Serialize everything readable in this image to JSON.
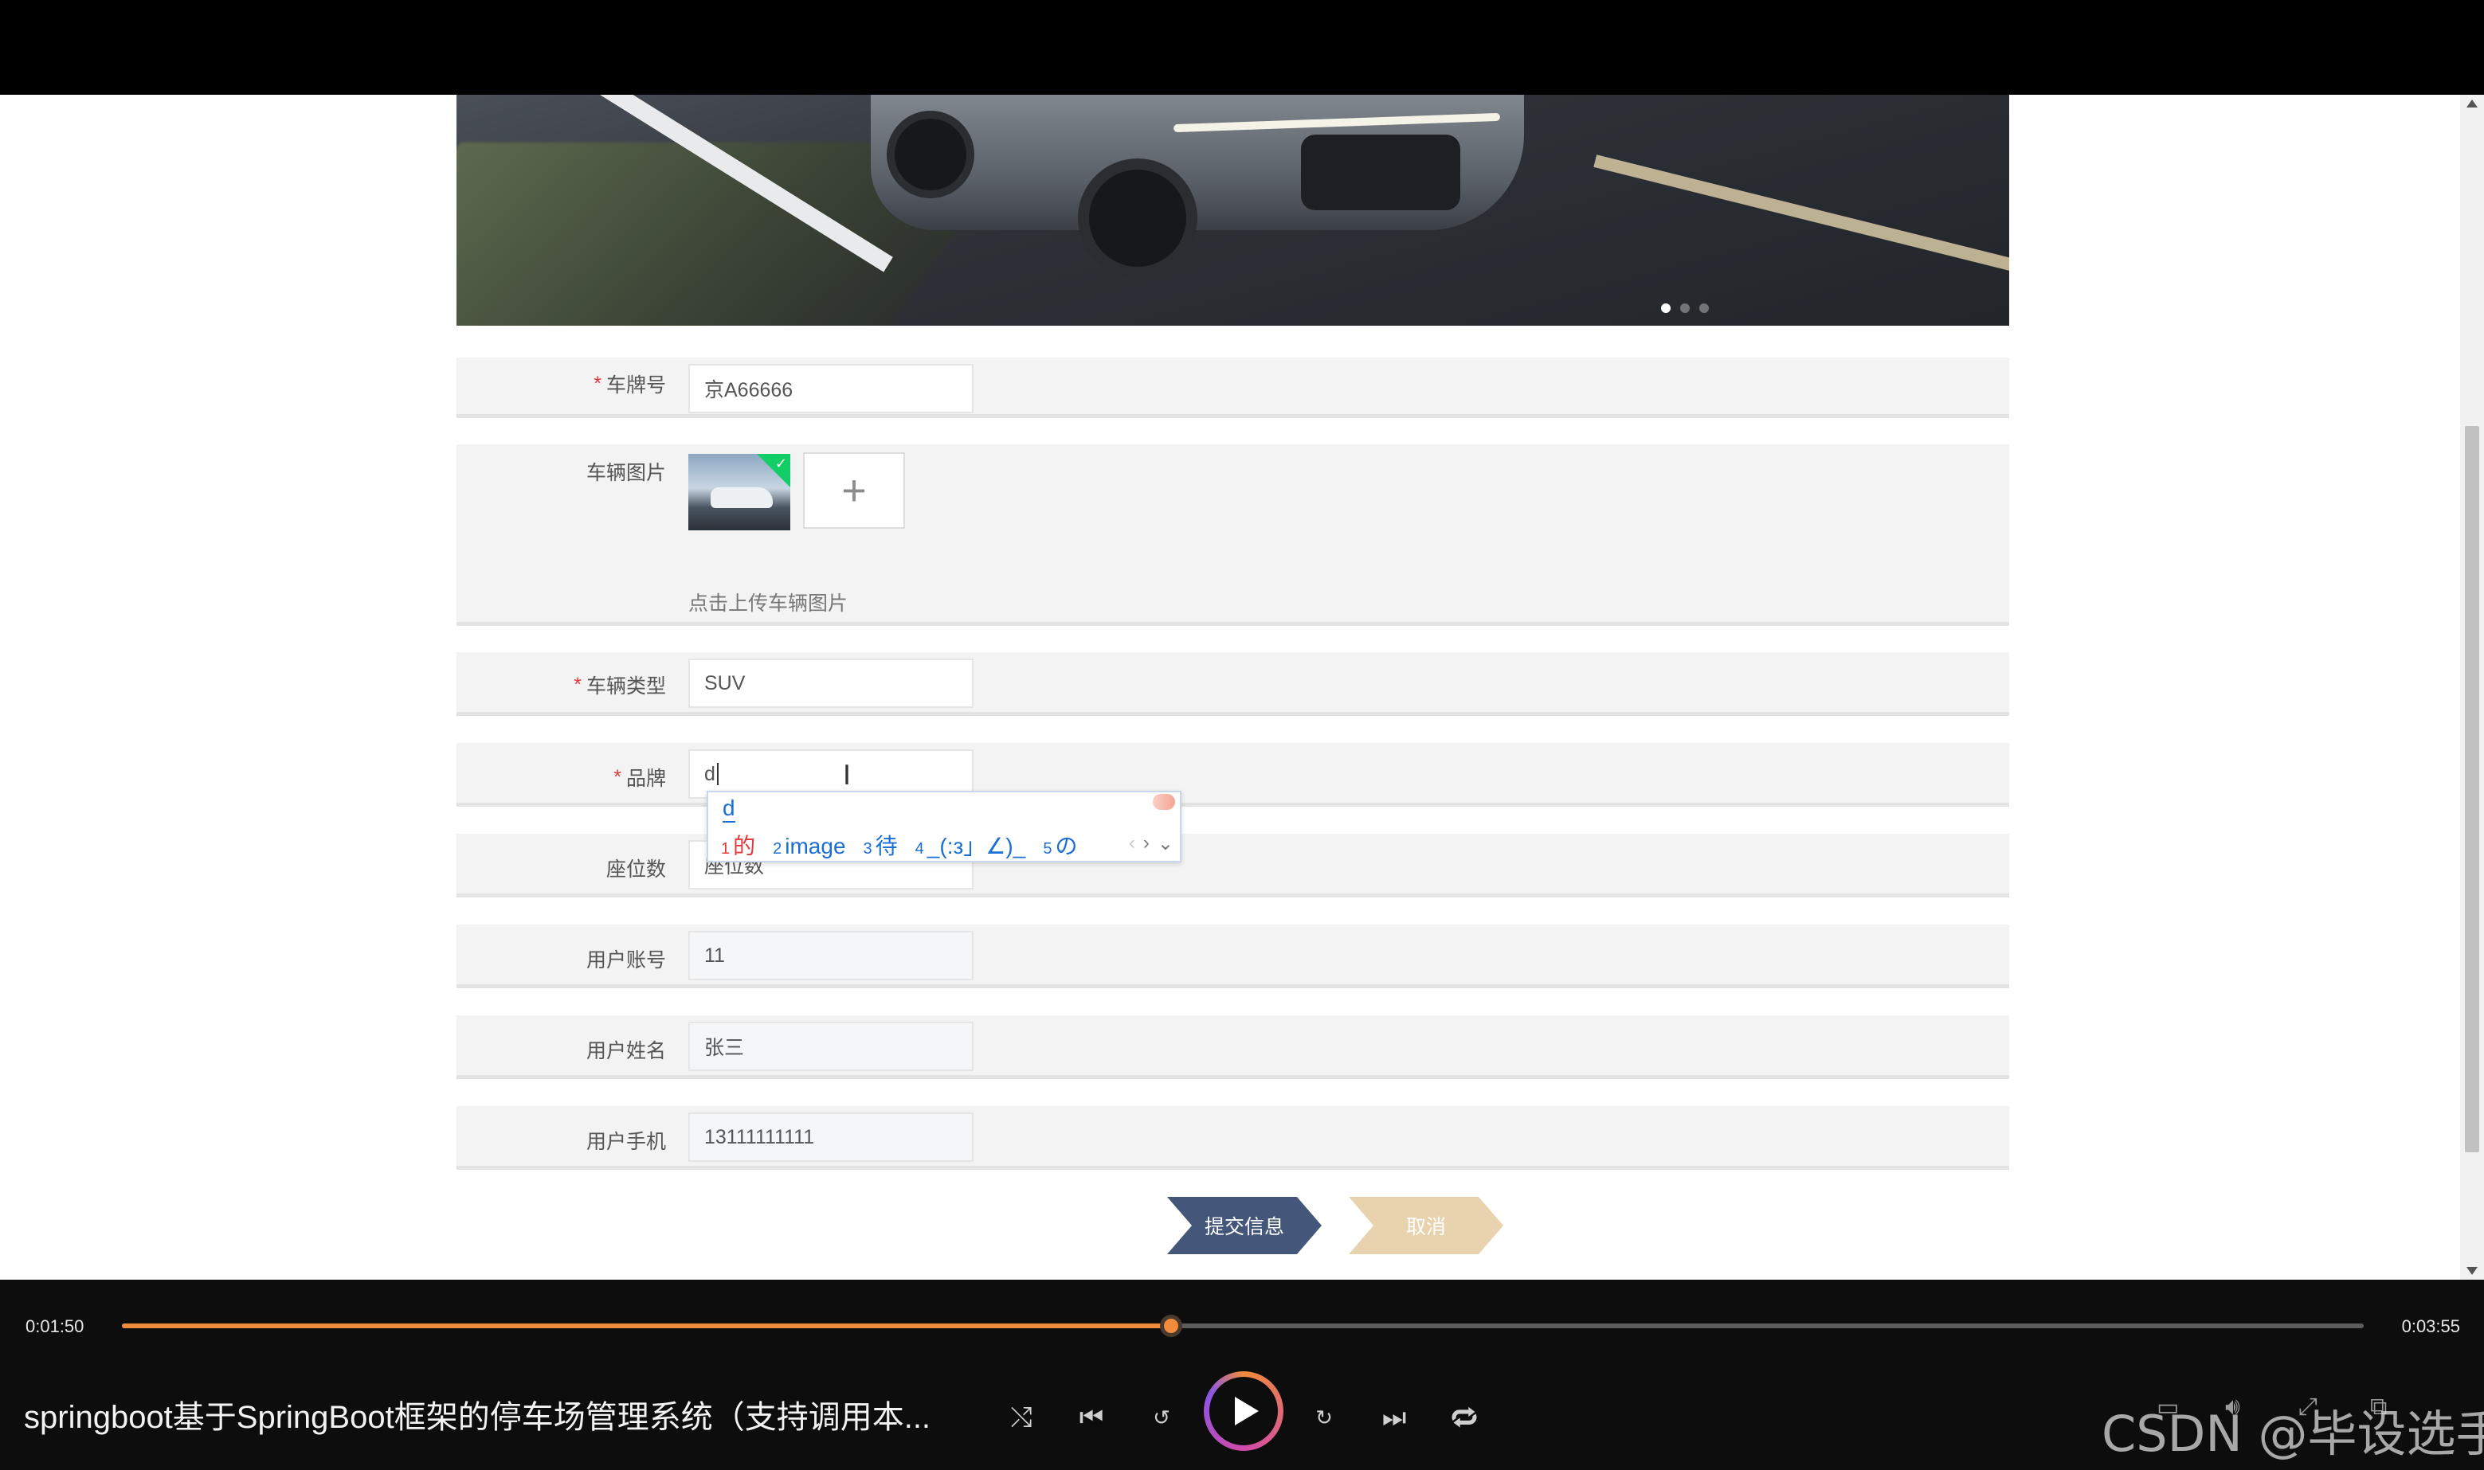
{
  "form": {
    "plate": {
      "label": "车牌号",
      "required": "*",
      "value": "京A66666"
    },
    "images": {
      "label": "车辆图片",
      "upload_plus": "+",
      "hint": "点击上传车辆图片",
      "check": "✓"
    },
    "type": {
      "label": "车辆类型",
      "required": "*",
      "value": "SUV"
    },
    "brand": {
      "label": "品牌",
      "required": "*",
      "value": "d"
    },
    "seats": {
      "label": "座位数",
      "value": "座位数"
    },
    "account": {
      "label": "用户账号",
      "value": "11"
    },
    "name": {
      "label": "用户姓名",
      "value": "张三"
    },
    "phone": {
      "label": "用户手机",
      "value": "13111111111"
    }
  },
  "ime": {
    "composition": "d",
    "candidates": [
      {
        "num": "1",
        "text": "的"
      },
      {
        "num": "2",
        "text": "image"
      },
      {
        "num": "3",
        "text": "待"
      },
      {
        "num": "4",
        "text": "_(:з」∠)_"
      },
      {
        "num": "5",
        "text": "の"
      }
    ],
    "prev": "‹",
    "next": "›",
    "expand": "⌄"
  },
  "buttons": {
    "submit": "提交信息",
    "cancel": "取消"
  },
  "player": {
    "current_time": "0:01:50",
    "total_time": "0:03:55",
    "progress": 0.468,
    "title": "springboot基于SpringBoot框架的停车场管理系统（支持调用本...",
    "watermark": "CSDN @毕设选手"
  },
  "colors": {
    "required": "#e4393c",
    "submit": "#44577a",
    "cancel": "#e9d3ae",
    "accent": "#f08c3c"
  }
}
